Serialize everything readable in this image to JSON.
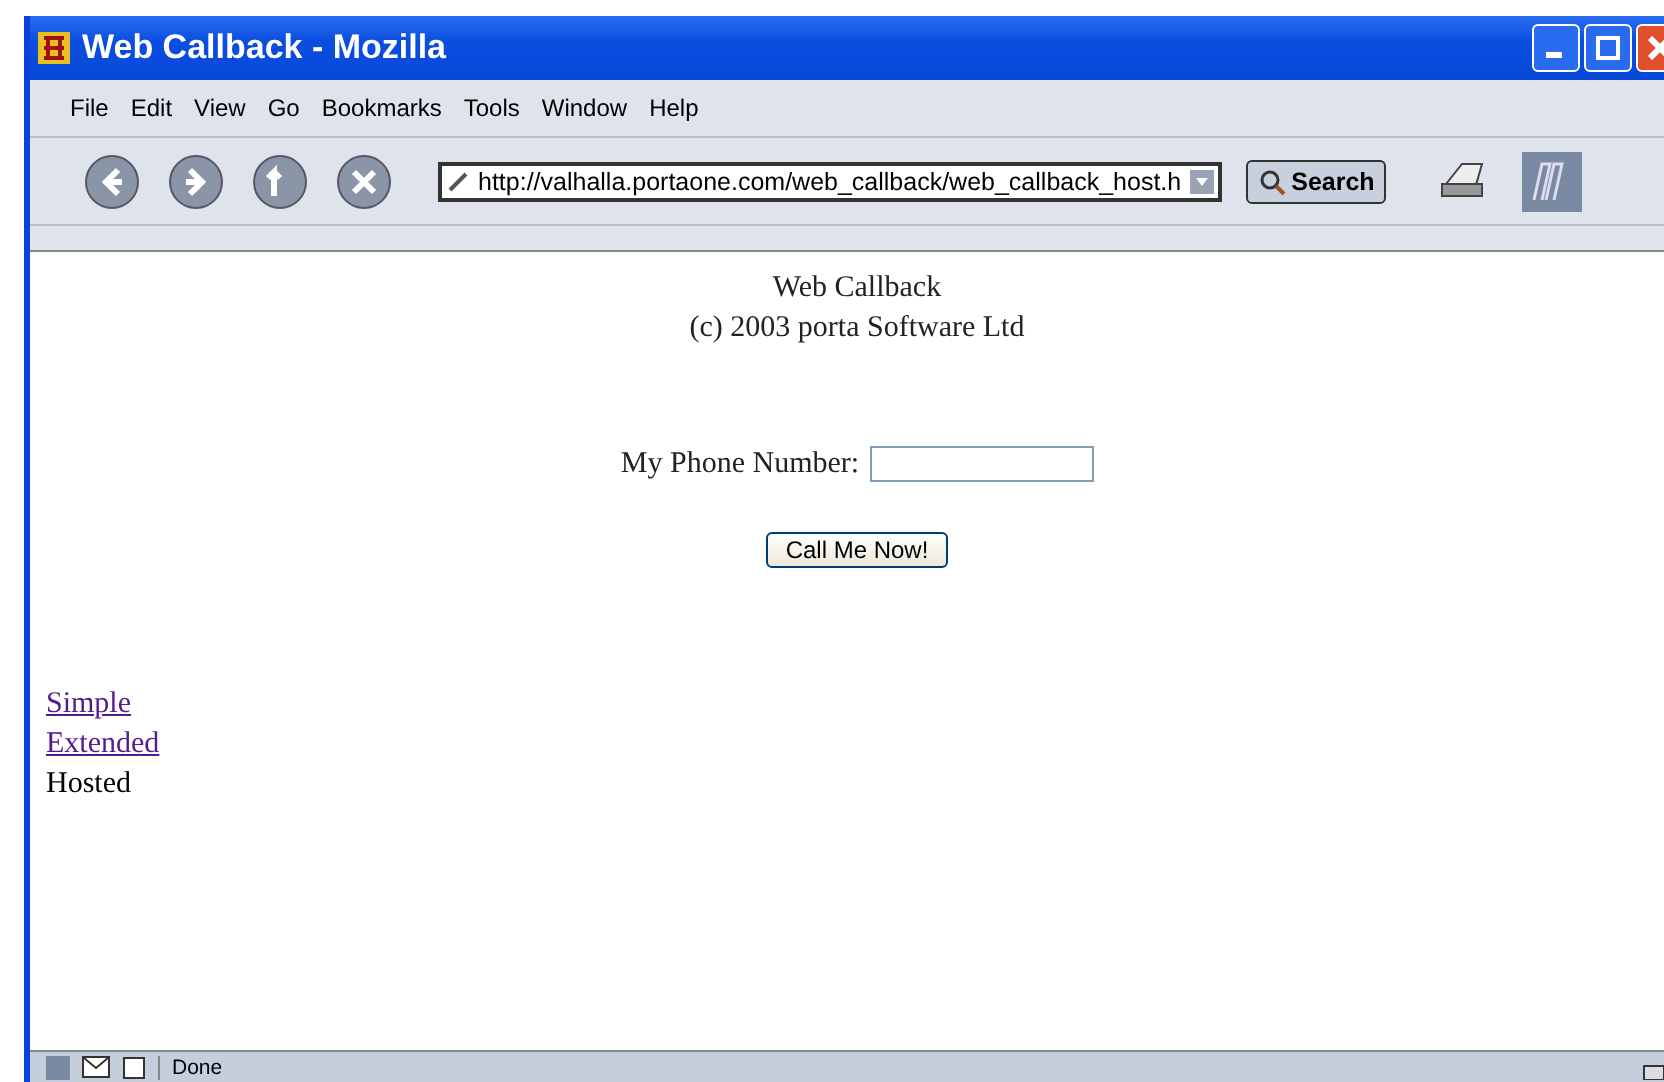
{
  "window": {
    "title": "Web Callback - Mozilla"
  },
  "menu": [
    "File",
    "Edit",
    "View",
    "Go",
    "Bookmarks",
    "Tools",
    "Window",
    "Help"
  ],
  "address_bar": {
    "value": "http://valhalla.portaone.com/web_callback/web_callback_host.h"
  },
  "search_button": "Search",
  "page": {
    "heading": "Web Callback",
    "copyright": "(c) 2003 porta Software Ltd",
    "phone_label": "My Phone Number:",
    "submit": "Call Me Now!",
    "nav": [
      {
        "label": "Simple",
        "kind": "link"
      },
      {
        "label": "Extended",
        "kind": "link"
      },
      {
        "label": "Hosted",
        "kind": "text"
      }
    ]
  },
  "status_bar": {
    "text": "Done"
  }
}
